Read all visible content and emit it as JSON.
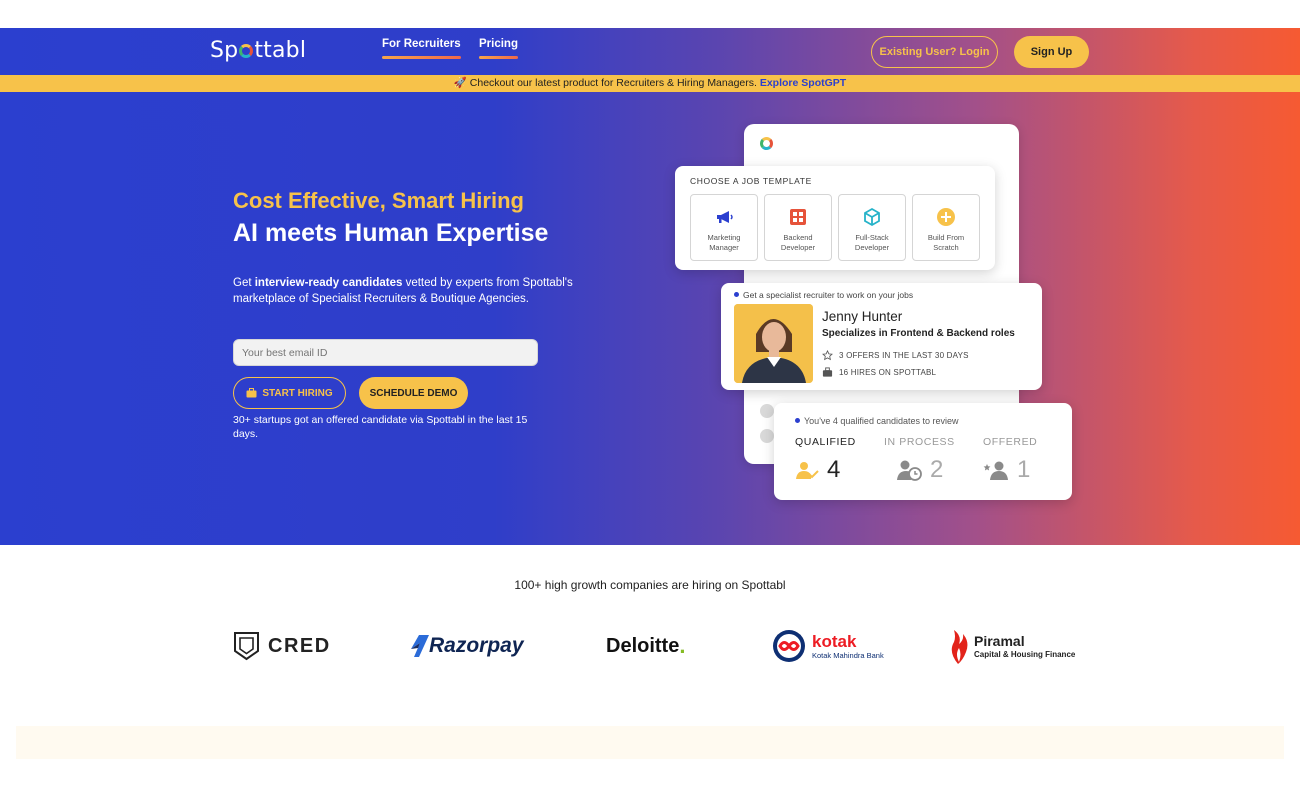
{
  "brand": {
    "name_prefix": "Sp",
    "name_suffix": "ttabl"
  },
  "nav": {
    "items": [
      {
        "label": "For Recruiters"
      },
      {
        "label": "Pricing"
      }
    ],
    "login_label": "Existing User? Login",
    "signup_label": "Sign Up"
  },
  "announcement": {
    "icon": "rocket-icon",
    "text": "Checkout our latest product for Recruiters & Hiring Managers.",
    "link_label": "Explore SpotGPT"
  },
  "hero": {
    "kicker": "Cost Effective, Smart Hiring",
    "headline": "AI meets Human Expertise",
    "desc_pre": "Get ",
    "desc_bold": "interview-ready candidates",
    "desc_post": " vetted by experts from Spottabl's marketplace of Specialist Recruiters & Boutique Agencies.",
    "email_placeholder": "Your best email ID",
    "start_label": "START HIRING",
    "demo_label": "SCHEDULE DEMO",
    "proof": "30+ startups got an offered candidate via Spottabl in the last 15 days."
  },
  "mockup": {
    "template_card": {
      "title": "CHOOSE A JOB TEMPLATE",
      "tiles": [
        {
          "line1": "Marketing",
          "line2": "Manager",
          "icon": "megaphone-icon"
        },
        {
          "line1": "Backend",
          "line2": "Developer",
          "icon": "server-icon"
        },
        {
          "line1": "Full-Stack",
          "line2": "Developer",
          "icon": "cube-icon"
        },
        {
          "line1": "Build From",
          "line2": "Scratch",
          "icon": "plus-circle-icon"
        }
      ]
    },
    "recruiter_card": {
      "top": "Get a specialist recruiter to work on your jobs",
      "name": "Jenny Hunter",
      "specialty": "Specializes in Frontend & Backend roles",
      "stat1": "3 OFFERS IN THE LAST 30 DAYS",
      "stat2": "16 HIRES ON SPOTTABL"
    },
    "candidates_card": {
      "top": "You've 4 qualified candidates to review",
      "columns": [
        {
          "label": "QUALIFIED",
          "count": "4"
        },
        {
          "label": "IN PROCESS",
          "count": "2"
        },
        {
          "label": "OFFERED",
          "count": "1"
        }
      ]
    }
  },
  "companies": {
    "title": "100+ high growth companies are hiring on Spottabl",
    "logos": [
      {
        "name": "CRED"
      },
      {
        "name": "Razorpay"
      },
      {
        "name": "Deloitte",
        "mark": "."
      },
      {
        "name": "kotak",
        "sub": "Kotak Mahindra Bank"
      },
      {
        "name": "Piramal",
        "sub": "Capital & Housing Finance"
      }
    ]
  },
  "colors": {
    "accent_yellow": "#f7c24a",
    "brand_blue": "#2b3fcf",
    "brand_orange": "#f65a32"
  }
}
